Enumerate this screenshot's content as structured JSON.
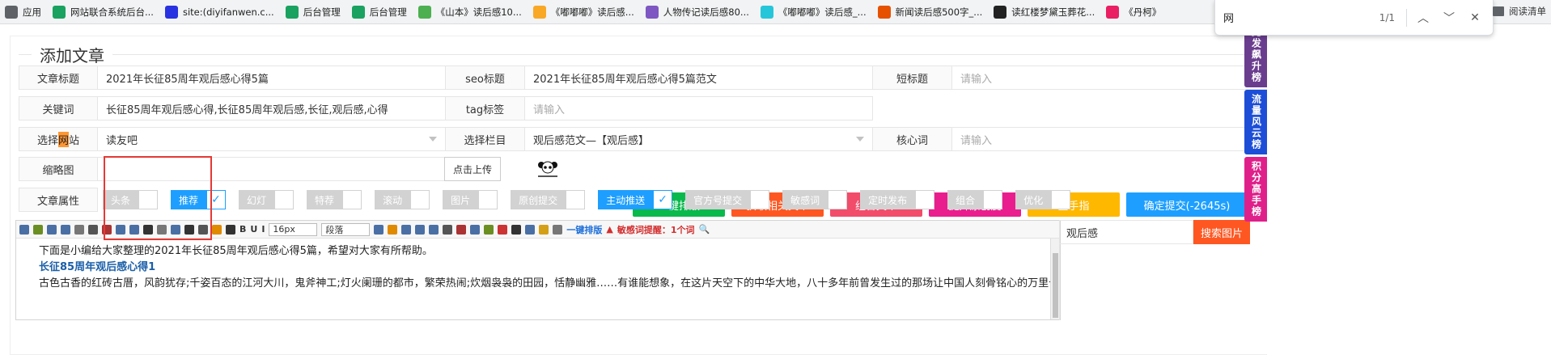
{
  "bookmarks": {
    "items": [
      {
        "label": "应用",
        "icon": "apps-grid-icon",
        "color": "#5f6368"
      },
      {
        "label": "网站联合系统后台...",
        "icon": "green-globe-icon",
        "color": "#1aa260"
      },
      {
        "label": "site:(diyifanwen.c...",
        "icon": "baidu-paw-icon",
        "color": "#2932e1"
      },
      {
        "label": "后台管理",
        "icon": "green-globe-icon",
        "color": "#1aa260"
      },
      {
        "label": "后台管理",
        "icon": "green-globe-icon",
        "color": "#1aa260"
      },
      {
        "label": "《山本》读后感10...",
        "icon": "wen-icon",
        "color": "#4caf50"
      },
      {
        "label": "《嘟嘟嘟》读后感...",
        "icon": "check-swirl-icon",
        "color": "#f9a825"
      },
      {
        "label": "人物传记读后感80...",
        "icon": "purple-book-icon",
        "color": "#7e57c2"
      },
      {
        "label": "《嘟嘟嘟》读后感_...",
        "icon": "cyan-book-icon",
        "color": "#26c6da"
      },
      {
        "label": "新闻读后感500字_...",
        "icon": "news-icon",
        "color": "#e65100"
      },
      {
        "label": "读红楼梦黛玉葬花...",
        "icon": "panda-icon",
        "color": "#222222"
      },
      {
        "label": "《丹柯》",
        "icon": "flower-icon",
        "color": "#e91e63"
      }
    ],
    "reading_list": "阅读清单"
  },
  "find_bar": {
    "query": "网",
    "count": "1/1"
  },
  "form": {
    "section_title": "添加文章",
    "title_label": "文章标题",
    "title_value": "2021年长征85周年观后感心得5篇",
    "seo_label": "seo标题",
    "seo_value": "2021年长征85周年观后感心得5篇范文",
    "short_label": "短标题",
    "short_placeholder": "请输入",
    "keywords_label": "关键词",
    "keywords_value": "长征85周年观后感心得,长征85周年观后感,长征,观后感,心得",
    "tag_label": "tag标签",
    "tag_placeholder": "请输入",
    "site_label_pre": "选择",
    "site_label_hl": "网",
    "site_label_post": "站",
    "site_value": "读友吧",
    "column_label": "选择栏目",
    "column_value": "观后感范文—【观后感】",
    "core_label": "核心词",
    "core_placeholder": "请输入",
    "thumb_label": "缩略图",
    "upload_label": "点击上传",
    "attr_label": "文章属性"
  },
  "actions": [
    {
      "label": "一键排版",
      "color": "#09b94c"
    },
    {
      "label": "获取相关文章",
      "color": "#ff5722"
    },
    {
      "label": "组合文章",
      "color": "#f24c6b"
    },
    {
      "label": "提升原创度",
      "color": "#ea1d8e"
    },
    {
      "label": "金手指",
      "color": "#ffb800"
    },
    {
      "label": "确定提交(-2645s)",
      "color": "#1e9fff"
    }
  ],
  "attributes": [
    {
      "label": "头条",
      "checked": false
    },
    {
      "label": "推荐",
      "checked": true
    },
    {
      "label": "幻灯",
      "checked": false
    },
    {
      "label": "特荐",
      "checked": false
    },
    {
      "label": "滚动",
      "checked": false
    },
    {
      "label": "图片",
      "checked": false
    },
    {
      "label": "原创提交",
      "checked": false
    },
    {
      "label": "主动推送",
      "checked": true
    },
    {
      "label": "官方号提交",
      "checked": false
    },
    {
      "label": "敏感词",
      "checked": false
    },
    {
      "label": "定时发布",
      "checked": false
    },
    {
      "label": "组合",
      "checked": false
    },
    {
      "label": "优化",
      "checked": false
    }
  ],
  "editor": {
    "font_size": "16px",
    "paragraph": "段落",
    "one_key_layout": "一键排版",
    "sensitive_warning": "敏感词提醒：1个词",
    "paragraphs": [
      {
        "text": "下面是小编给大家整理的2021年长征85周年观后感心得5篇，希望对大家有所帮助。",
        "heading": false
      },
      {
        "text": "长征85周年观后感心得1",
        "heading": true
      },
      {
        "text": "古色古香的红砖古厝，风韵犹存;千姿百态的江河大川，鬼斧神工;灯火阑珊的都市，繁荣热闹;炊烟袅袅的田园，恬静幽雅……有谁能想象，在这片天空下的中华大地，八十多年前曾发生过的那场让中国人刻骨铭心的万里长征是何等悲壮!",
        "heading": false
      }
    ]
  },
  "side": {
    "search_value": "观后感",
    "search_button": "搜索图片"
  },
  "float_tabs": [
    {
      "label": "竞发飙升榜",
      "color": "#6a3d8f"
    },
    {
      "label": "流量风云榜",
      "color": "#1d4ed8"
    },
    {
      "label": "积分高手榜",
      "color": "#e0208a"
    }
  ]
}
